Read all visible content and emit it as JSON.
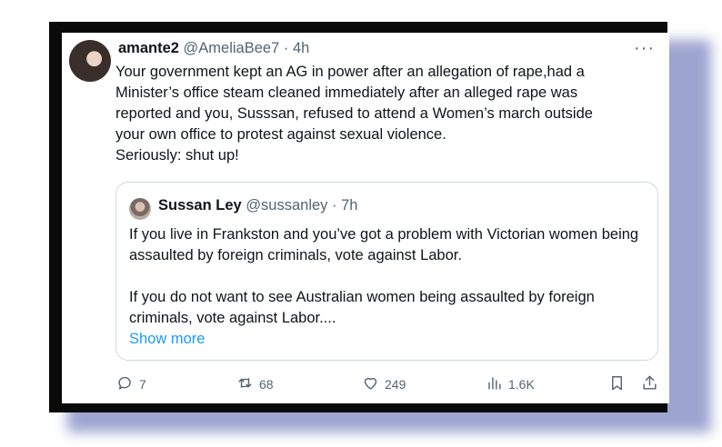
{
  "tweet": {
    "author_name": "amante2",
    "author_handle": "@AmeliaBee7",
    "separator": "·",
    "time": "4h",
    "more_label": "···",
    "lines": [
      "Your government kept an AG in power after an allegation of rape,had a",
      "Minister’s office steam cleaned immediately after an alleged rape was",
      "reported and you, Susssan, refused to attend a Women’s march outside",
      "your own office to protest against sexual violence.",
      "Seriously: shut up!"
    ]
  },
  "quote": {
    "author_name": "Sussan Ley",
    "author_handle": "@sussanley",
    "separator": "·",
    "time": "7h",
    "paragraph1": "If you live in Frankston and you’ve got a problem with Victorian women being assaulted by foreign criminals, vote against Labor.",
    "paragraph2": "If you do not want to see Australian women being assaulted by foreign criminals, vote against Labor....",
    "show_more": "Show more"
  },
  "actions": {
    "replies": "7",
    "reposts": "68",
    "likes": "249",
    "views": "1.6K"
  },
  "icons": [
    "reply-icon",
    "repost-icon",
    "like-icon",
    "views-icon",
    "bookmark-icon",
    "share-icon"
  ],
  "colors": {
    "link": "#1d9bf0",
    "secondary_text": "#536471",
    "frame": "#0a0a0a",
    "shadow": "#8c95c8"
  }
}
